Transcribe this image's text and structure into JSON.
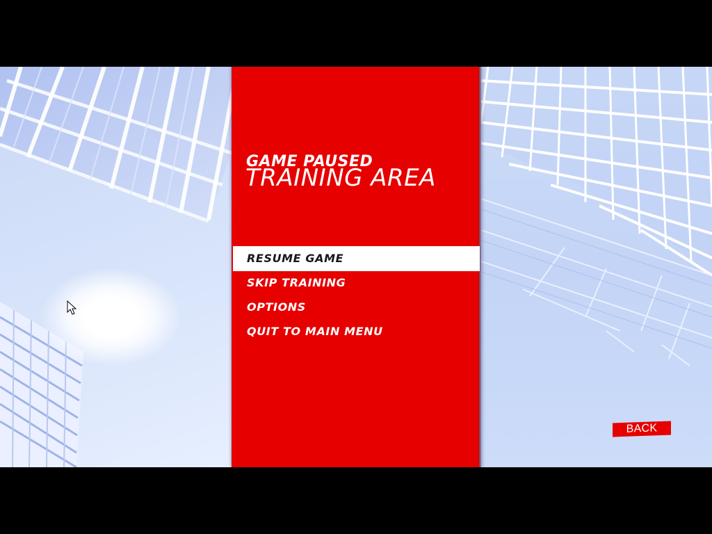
{
  "pause_menu": {
    "status_label": "GAME PAUSED",
    "location_label": "TRAINING AREA",
    "items": [
      {
        "label": "RESUME GAME",
        "selected": true
      },
      {
        "label": "SKIP TRAINING",
        "selected": false
      },
      {
        "label": "OPTIONS",
        "selected": false
      },
      {
        "label": "QUIT TO MAIN MENU",
        "selected": false
      }
    ]
  },
  "back_button": {
    "label": "BACK"
  },
  "colors": {
    "accent_red": "#e60000",
    "sky_blue": "#c9d9f8",
    "selected_bg": "#ffffff",
    "selected_text": "#17171f",
    "text": "#ffffff"
  },
  "icons": {
    "cursor": "arrow-cursor-icon"
  }
}
